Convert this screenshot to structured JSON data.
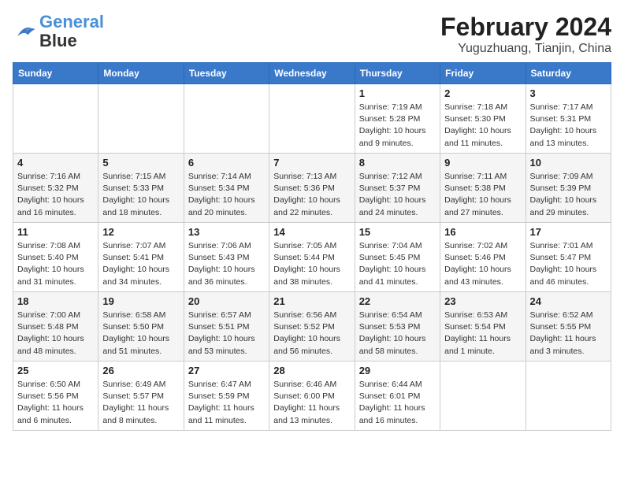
{
  "header": {
    "logo_line1": "General",
    "logo_line2": "Blue",
    "month_title": "February 2024",
    "location": "Yuguzhuang, Tianjin, China"
  },
  "weekdays": [
    "Sunday",
    "Monday",
    "Tuesday",
    "Wednesday",
    "Thursday",
    "Friday",
    "Saturday"
  ],
  "weeks": [
    [
      {
        "day": "",
        "info": ""
      },
      {
        "day": "",
        "info": ""
      },
      {
        "day": "",
        "info": ""
      },
      {
        "day": "",
        "info": ""
      },
      {
        "day": "1",
        "info": "Sunrise: 7:19 AM\nSunset: 5:28 PM\nDaylight: 10 hours\nand 9 minutes."
      },
      {
        "day": "2",
        "info": "Sunrise: 7:18 AM\nSunset: 5:30 PM\nDaylight: 10 hours\nand 11 minutes."
      },
      {
        "day": "3",
        "info": "Sunrise: 7:17 AM\nSunset: 5:31 PM\nDaylight: 10 hours\nand 13 minutes."
      }
    ],
    [
      {
        "day": "4",
        "info": "Sunrise: 7:16 AM\nSunset: 5:32 PM\nDaylight: 10 hours\nand 16 minutes."
      },
      {
        "day": "5",
        "info": "Sunrise: 7:15 AM\nSunset: 5:33 PM\nDaylight: 10 hours\nand 18 minutes."
      },
      {
        "day": "6",
        "info": "Sunrise: 7:14 AM\nSunset: 5:34 PM\nDaylight: 10 hours\nand 20 minutes."
      },
      {
        "day": "7",
        "info": "Sunrise: 7:13 AM\nSunset: 5:36 PM\nDaylight: 10 hours\nand 22 minutes."
      },
      {
        "day": "8",
        "info": "Sunrise: 7:12 AM\nSunset: 5:37 PM\nDaylight: 10 hours\nand 24 minutes."
      },
      {
        "day": "9",
        "info": "Sunrise: 7:11 AM\nSunset: 5:38 PM\nDaylight: 10 hours\nand 27 minutes."
      },
      {
        "day": "10",
        "info": "Sunrise: 7:09 AM\nSunset: 5:39 PM\nDaylight: 10 hours\nand 29 minutes."
      }
    ],
    [
      {
        "day": "11",
        "info": "Sunrise: 7:08 AM\nSunset: 5:40 PM\nDaylight: 10 hours\nand 31 minutes."
      },
      {
        "day": "12",
        "info": "Sunrise: 7:07 AM\nSunset: 5:41 PM\nDaylight: 10 hours\nand 34 minutes."
      },
      {
        "day": "13",
        "info": "Sunrise: 7:06 AM\nSunset: 5:43 PM\nDaylight: 10 hours\nand 36 minutes."
      },
      {
        "day": "14",
        "info": "Sunrise: 7:05 AM\nSunset: 5:44 PM\nDaylight: 10 hours\nand 38 minutes."
      },
      {
        "day": "15",
        "info": "Sunrise: 7:04 AM\nSunset: 5:45 PM\nDaylight: 10 hours\nand 41 minutes."
      },
      {
        "day": "16",
        "info": "Sunrise: 7:02 AM\nSunset: 5:46 PM\nDaylight: 10 hours\nand 43 minutes."
      },
      {
        "day": "17",
        "info": "Sunrise: 7:01 AM\nSunset: 5:47 PM\nDaylight: 10 hours\nand 46 minutes."
      }
    ],
    [
      {
        "day": "18",
        "info": "Sunrise: 7:00 AM\nSunset: 5:48 PM\nDaylight: 10 hours\nand 48 minutes."
      },
      {
        "day": "19",
        "info": "Sunrise: 6:58 AM\nSunset: 5:50 PM\nDaylight: 10 hours\nand 51 minutes."
      },
      {
        "day": "20",
        "info": "Sunrise: 6:57 AM\nSunset: 5:51 PM\nDaylight: 10 hours\nand 53 minutes."
      },
      {
        "day": "21",
        "info": "Sunrise: 6:56 AM\nSunset: 5:52 PM\nDaylight: 10 hours\nand 56 minutes."
      },
      {
        "day": "22",
        "info": "Sunrise: 6:54 AM\nSunset: 5:53 PM\nDaylight: 10 hours\nand 58 minutes."
      },
      {
        "day": "23",
        "info": "Sunrise: 6:53 AM\nSunset: 5:54 PM\nDaylight: 11 hours\nand 1 minute."
      },
      {
        "day": "24",
        "info": "Sunrise: 6:52 AM\nSunset: 5:55 PM\nDaylight: 11 hours\nand 3 minutes."
      }
    ],
    [
      {
        "day": "25",
        "info": "Sunrise: 6:50 AM\nSunset: 5:56 PM\nDaylight: 11 hours\nand 6 minutes."
      },
      {
        "day": "26",
        "info": "Sunrise: 6:49 AM\nSunset: 5:57 PM\nDaylight: 11 hours\nand 8 minutes."
      },
      {
        "day": "27",
        "info": "Sunrise: 6:47 AM\nSunset: 5:59 PM\nDaylight: 11 hours\nand 11 minutes."
      },
      {
        "day": "28",
        "info": "Sunrise: 6:46 AM\nSunset: 6:00 PM\nDaylight: 11 hours\nand 13 minutes."
      },
      {
        "day": "29",
        "info": "Sunrise: 6:44 AM\nSunset: 6:01 PM\nDaylight: 11 hours\nand 16 minutes."
      },
      {
        "day": "",
        "info": ""
      },
      {
        "day": "",
        "info": ""
      }
    ]
  ]
}
